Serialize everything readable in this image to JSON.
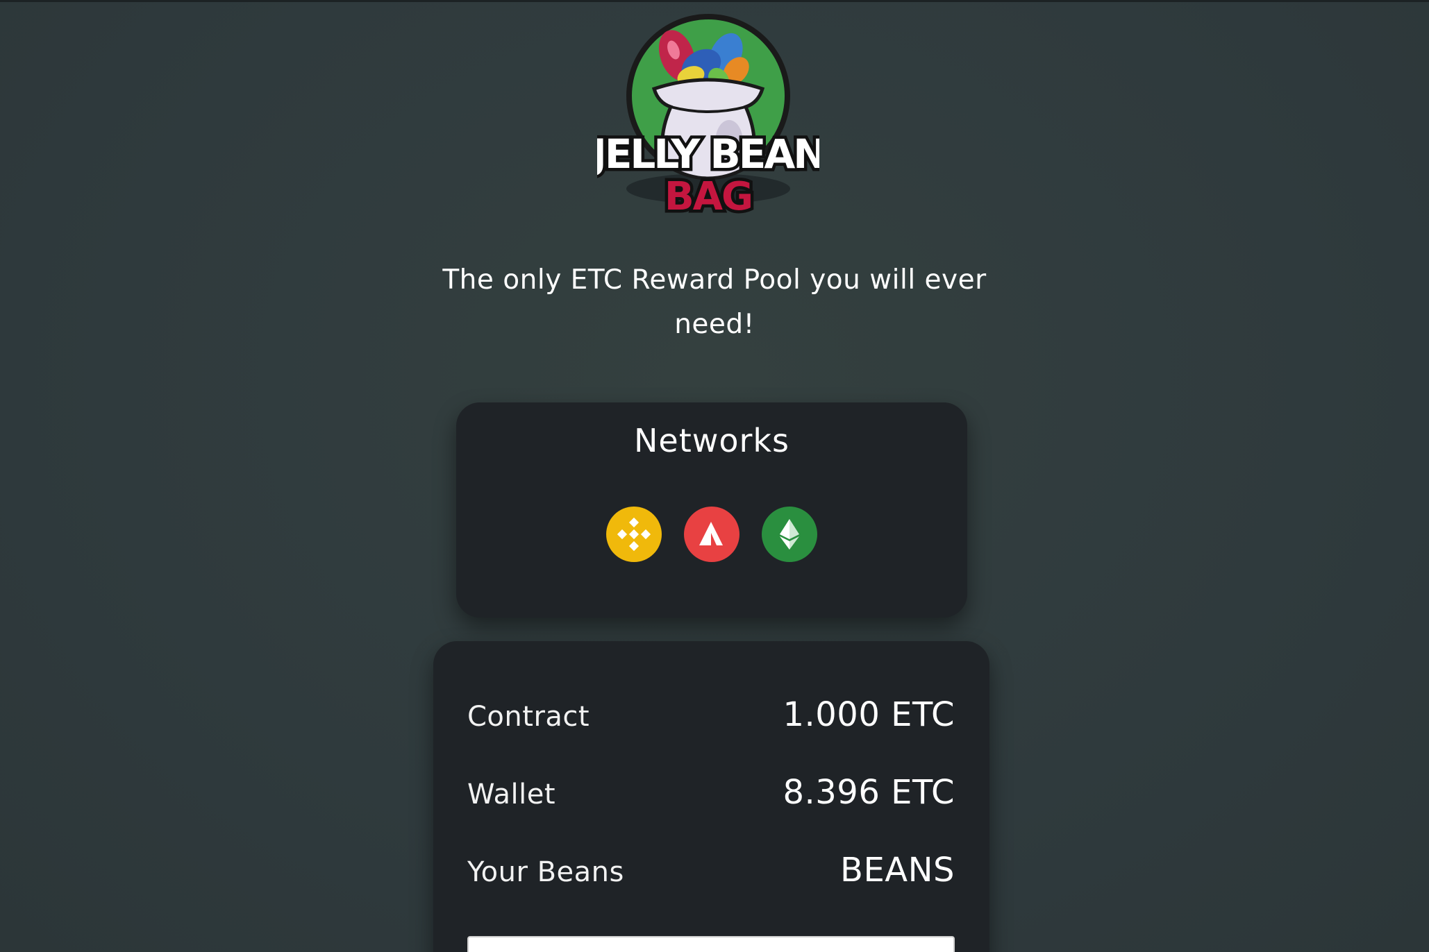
{
  "brand": {
    "logo_line1": "JELLY BEAN",
    "logo_line2": "BAG"
  },
  "tagline": "The only ETC Reward Pool you will ever need!",
  "networks": {
    "title": "Networks",
    "items": [
      {
        "name": "bnb-chain-icon",
        "color": "#f0b90b"
      },
      {
        "name": "avalanche-icon",
        "color": "#e84142"
      },
      {
        "name": "ethereum-classic-icon",
        "color": "#2a8f3f"
      }
    ]
  },
  "stats": {
    "contract_label": "Contract",
    "contract_value": "1.000 ETC",
    "wallet_label": "Wallet",
    "wallet_value": "8.396 ETC",
    "beans_label": "Your Beans",
    "beans_value": "BEANS"
  },
  "input": {
    "value": ""
  }
}
